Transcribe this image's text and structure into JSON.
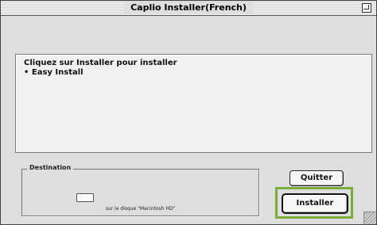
{
  "window": {
    "title": "Caplio Installer(French)"
  },
  "info": {
    "line1": "Cliquez sur Installer pour installer",
    "line2": "• Easy Install"
  },
  "destination": {
    "legend": "Destination",
    "disk_text": "sur le disque \"Macintosh HD\""
  },
  "buttons": {
    "quit_label": "Quitter",
    "install_label": "Installer"
  },
  "colors": {
    "default_button_highlight": "#7aae3a"
  }
}
